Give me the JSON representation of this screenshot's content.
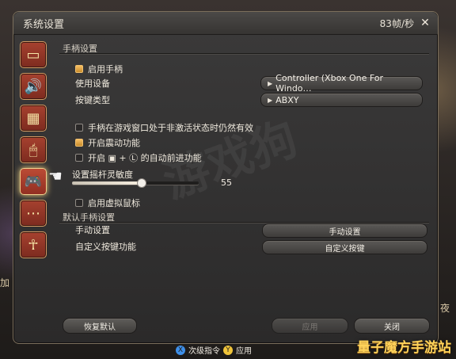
{
  "window": {
    "title": "系统设置",
    "fps_text": "83帧/秒"
  },
  "sidebar": {
    "items": [
      {
        "icon": "monitor-icon"
      },
      {
        "icon": "speaker-icon"
      },
      {
        "icon": "layout-icon"
      },
      {
        "icon": "mouse-icon"
      },
      {
        "icon": "controller-icon",
        "active": true
      },
      {
        "icon": "more-icon"
      },
      {
        "icon": "person-icon"
      }
    ]
  },
  "section_controller": {
    "title": "手柄设置",
    "enable_label": "启用手柄",
    "device_label": "使用设备",
    "device_value": "Controller (Xbox One For Windo…",
    "button_type_label": "按键类型",
    "button_type_value": "ABXY",
    "keep_active_label": "手柄在游戏窗口处于非激活状态时仍然有效",
    "vibration_label": "开启震动功能",
    "auto_forward_label": "开启 ▣ + Ⓛ 的自动前进功能",
    "sensitivity_label": "设置摇杆灵敏度",
    "sensitivity_value": "55",
    "virtual_mouse_label": "启用虚拟鼠标"
  },
  "section_default": {
    "title": "默认手柄设置",
    "manual_label": "手动设置",
    "manual_button": "手动设置",
    "custom_label": "自定义按键功能",
    "custom_button": "自定义按键"
  },
  "footer": {
    "reset": "恢复默认",
    "apply": "应用",
    "close": "关闭"
  },
  "hint": {
    "next": "次级指令",
    "apply": "应用",
    "x_glyph": "X",
    "y_glyph": "Y"
  },
  "brand": "量子魔方手游站",
  "watermark": "游戏狗",
  "colors": {
    "accent": "#f7bf63",
    "sidebar_red": "#8f3325",
    "window_bg": "#333131"
  }
}
